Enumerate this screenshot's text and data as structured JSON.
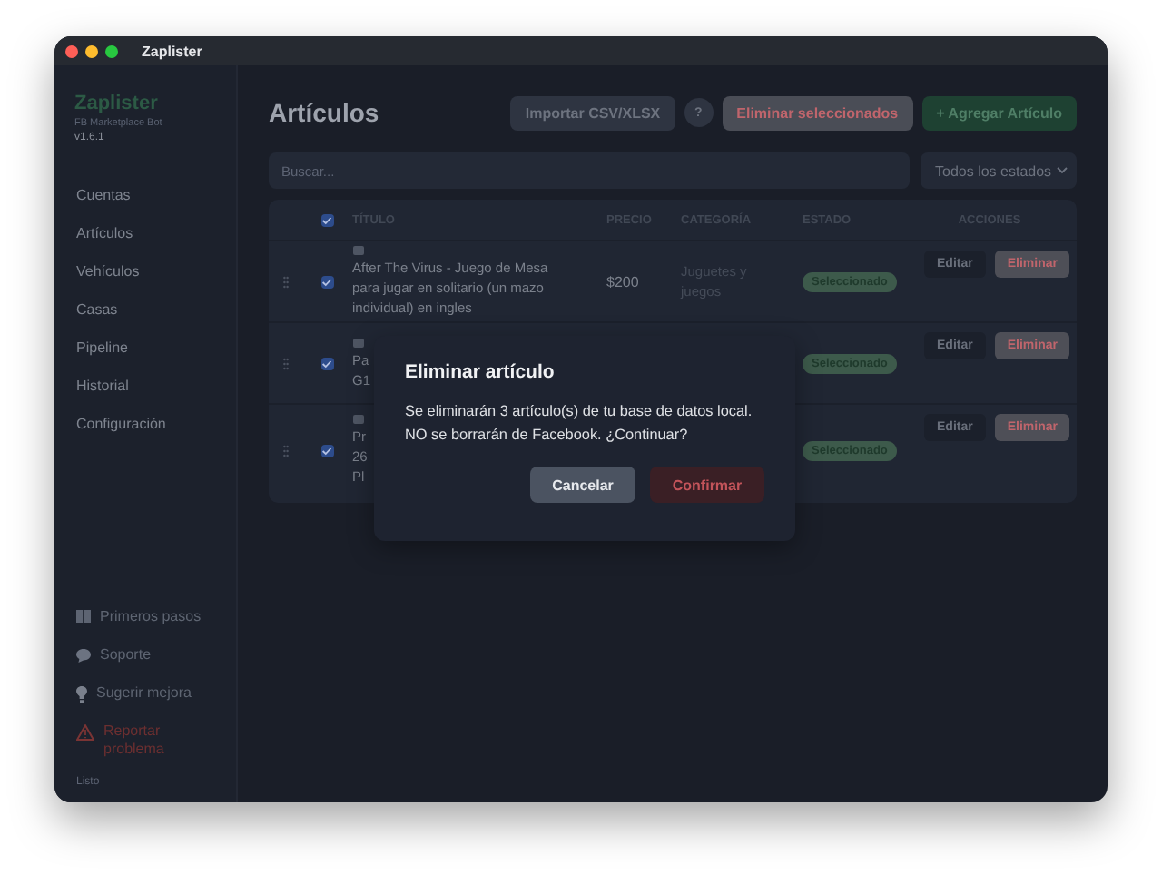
{
  "window": {
    "title": "Zaplister"
  },
  "sidebar": {
    "app_name": "Zaplister",
    "subtitle": "FB Marketplace Bot",
    "version": "v1.6.1",
    "items": [
      {
        "label": "Cuentas"
      },
      {
        "label": "Artículos"
      },
      {
        "label": "Vehículos"
      },
      {
        "label": "Casas"
      },
      {
        "label": "Pipeline"
      },
      {
        "label": "Historial"
      },
      {
        "label": "Configuración"
      }
    ],
    "footer_links": [
      {
        "kind": "book",
        "label": "Primeros pasos"
      },
      {
        "kind": "chat",
        "label": "Soporte"
      },
      {
        "kind": "bulb",
        "label": "Sugerir mejora"
      },
      {
        "kind": "warning",
        "label": "Reportar problema"
      }
    ],
    "status": "Listo"
  },
  "header": {
    "title": "Artículos",
    "buttons": [
      {
        "kind": "secondary",
        "label": "Importar CSV/XLSX"
      },
      {
        "kind": "help",
        "label": "?"
      },
      {
        "kind": "danger",
        "label": "Eliminar seleccionados"
      },
      {
        "kind": "primary",
        "label": "+ Agregar Artículo"
      }
    ]
  },
  "filters": {
    "search": {
      "placeholder": "Buscar..."
    },
    "status_select": "Todos los estados"
  },
  "table": {
    "header_checked": true,
    "columns": [
      "TÍTULO",
      "PRECIO",
      "CATEGORÍA",
      "ESTADO",
      "ACCIONES"
    ],
    "rows": [
      {
        "checked": true,
        "title_lines": [
          "After The Virus - Juego de Mesa",
          "para jugar en solitario (un mazo",
          "individual) en ingles"
        ],
        "price": "$200",
        "category": "Juguetes y juegos",
        "status": "Seleccionado",
        "actions": [
          "Editar",
          "Eliminar"
        ]
      },
      {
        "checked": true,
        "title_lines": [
          "Pa",
          "G1"
        ],
        "status": "Seleccionado",
        "actions": [
          "Editar",
          "Eliminar"
        ]
      },
      {
        "checked": true,
        "title_lines": [
          "Pr",
          "26",
          "Pl"
        ],
        "status": "Seleccionado",
        "actions": [
          "Editar",
          "Eliminar"
        ]
      }
    ]
  },
  "dialog": {
    "title": "Eliminar artículo",
    "message": "Se eliminarán 3 artículo(s) de tu base de datos local. NO se borrarán de Facebook. ¿Continuar?",
    "buttons": [
      {
        "kind": "cancel",
        "label": "Cancelar"
      },
      {
        "kind": "confirm",
        "label": "Confirmar"
      }
    ]
  }
}
